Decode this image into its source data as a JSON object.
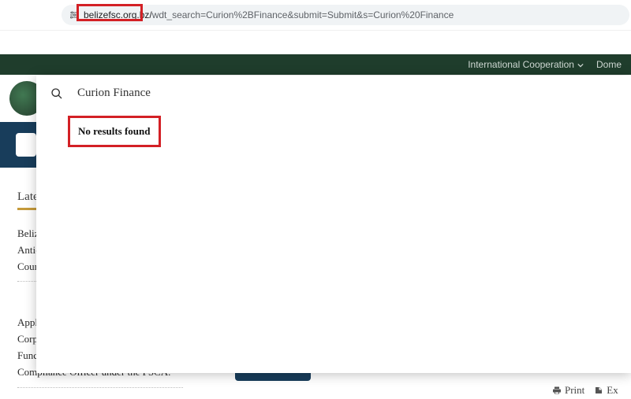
{
  "address": {
    "domain": "belizefsc.org.bz/",
    "path": "wdt_search=Curion%2BFinance&submit=Submit&s=Curion%20Finance"
  },
  "nav": {
    "international": "International Cooperation",
    "domestic": "Dome"
  },
  "search": {
    "value": "Curion Finance",
    "no_results": "No results found"
  },
  "sidebar": {
    "heading": "Late",
    "item1": "Beliz",
    "item2": "Anti-",
    "item3": "Coun",
    "item4": "Appl",
    "item5": "Corp",
    "item6": "Func",
    "item7": "Compliance Officer under the FSCA."
  },
  "footer": {
    "print": "Print",
    "export": "Ex"
  }
}
